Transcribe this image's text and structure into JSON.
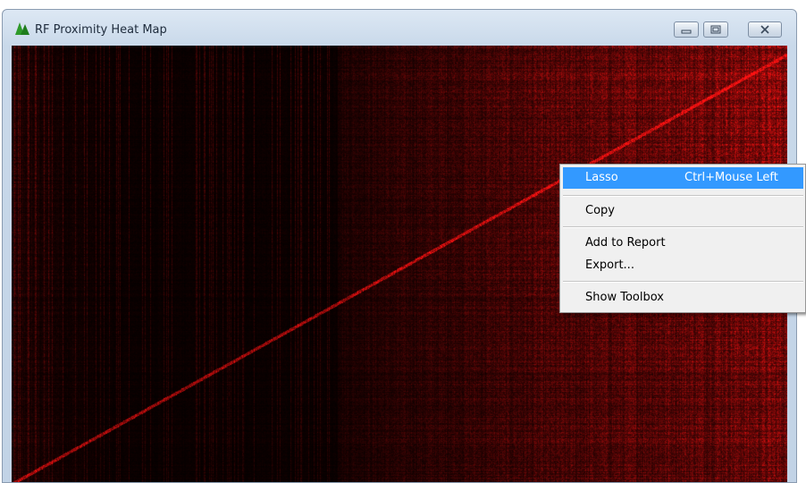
{
  "window": {
    "title": "RF Proximity Heat Map",
    "icon": "green-tree-icon",
    "buttons": [
      "minimize-icon",
      "maximize-icon",
      "close-icon"
    ]
  },
  "heatmap": {
    "color": "#ff2020",
    "background": "#000000"
  },
  "context_menu": {
    "items": [
      {
        "label": "Lasso",
        "shortcut": "Ctrl+Mouse Left",
        "highlighted": true
      },
      {
        "label": "Copy"
      },
      {
        "label": "Add to Report"
      },
      {
        "label": "Export..."
      },
      {
        "label": "Show Toolbox"
      }
    ],
    "highlight_color": "#3399ff"
  }
}
